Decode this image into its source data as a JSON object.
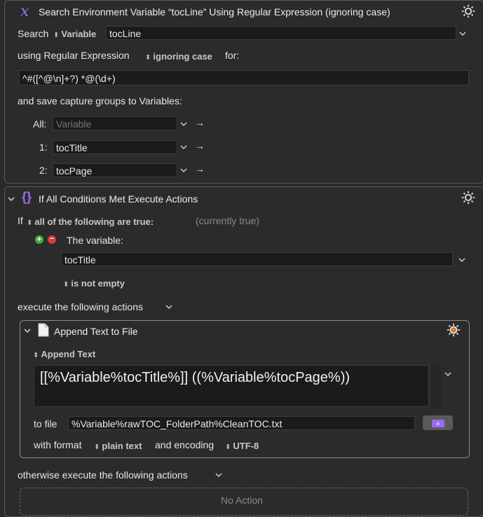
{
  "search_action": {
    "title": "Search Environment Variable “tocLine” Using Regular Expression (ignoring case)",
    "search_label": "Search",
    "source_type": "Variable",
    "variable_name": "tocLine",
    "using_label": "using Regular Expression",
    "case_mode": "ignoring case",
    "for_label": "for:",
    "regex": "^#([^@\\n]+?) *@(\\d+)",
    "save_label": "and save capture groups to Variables:",
    "groups": [
      {
        "label": "All:",
        "value": "",
        "placeholder": "Variable"
      },
      {
        "label": "1:",
        "value": "tocTitle",
        "placeholder": ""
      },
      {
        "label": "2:",
        "value": "tocPage",
        "placeholder": ""
      }
    ]
  },
  "if_action": {
    "title": "If All Conditions Met Execute Actions",
    "if_label": "If",
    "condition_mode": "all of the following are true:",
    "status": "(currently true)",
    "condition_label": "The variable:",
    "variable": "tocTitle",
    "test": "is not empty",
    "execute_label": "execute the following actions",
    "otherwise_label": "otherwise execute the following actions",
    "no_action": "No Action"
  },
  "append_action": {
    "title": "Append Text to File",
    "mode": "Append Text",
    "text": "[[%Variable%tocTitle%]] ((%Variable%tocPage%))",
    "to_file_label": "to file",
    "file_path": "%Variable%rawTOC_FolderPath%CleanTOC.txt",
    "with_format_label": "with format",
    "format": "plain text",
    "encoding_label": "and encoding",
    "encoding": "UTF-8"
  },
  "colors": {
    "accent_purple": "#9b6cf0",
    "plus_green": "#3fae3f",
    "minus_red": "#d93b3b",
    "gear_orange": "#e07a28"
  }
}
